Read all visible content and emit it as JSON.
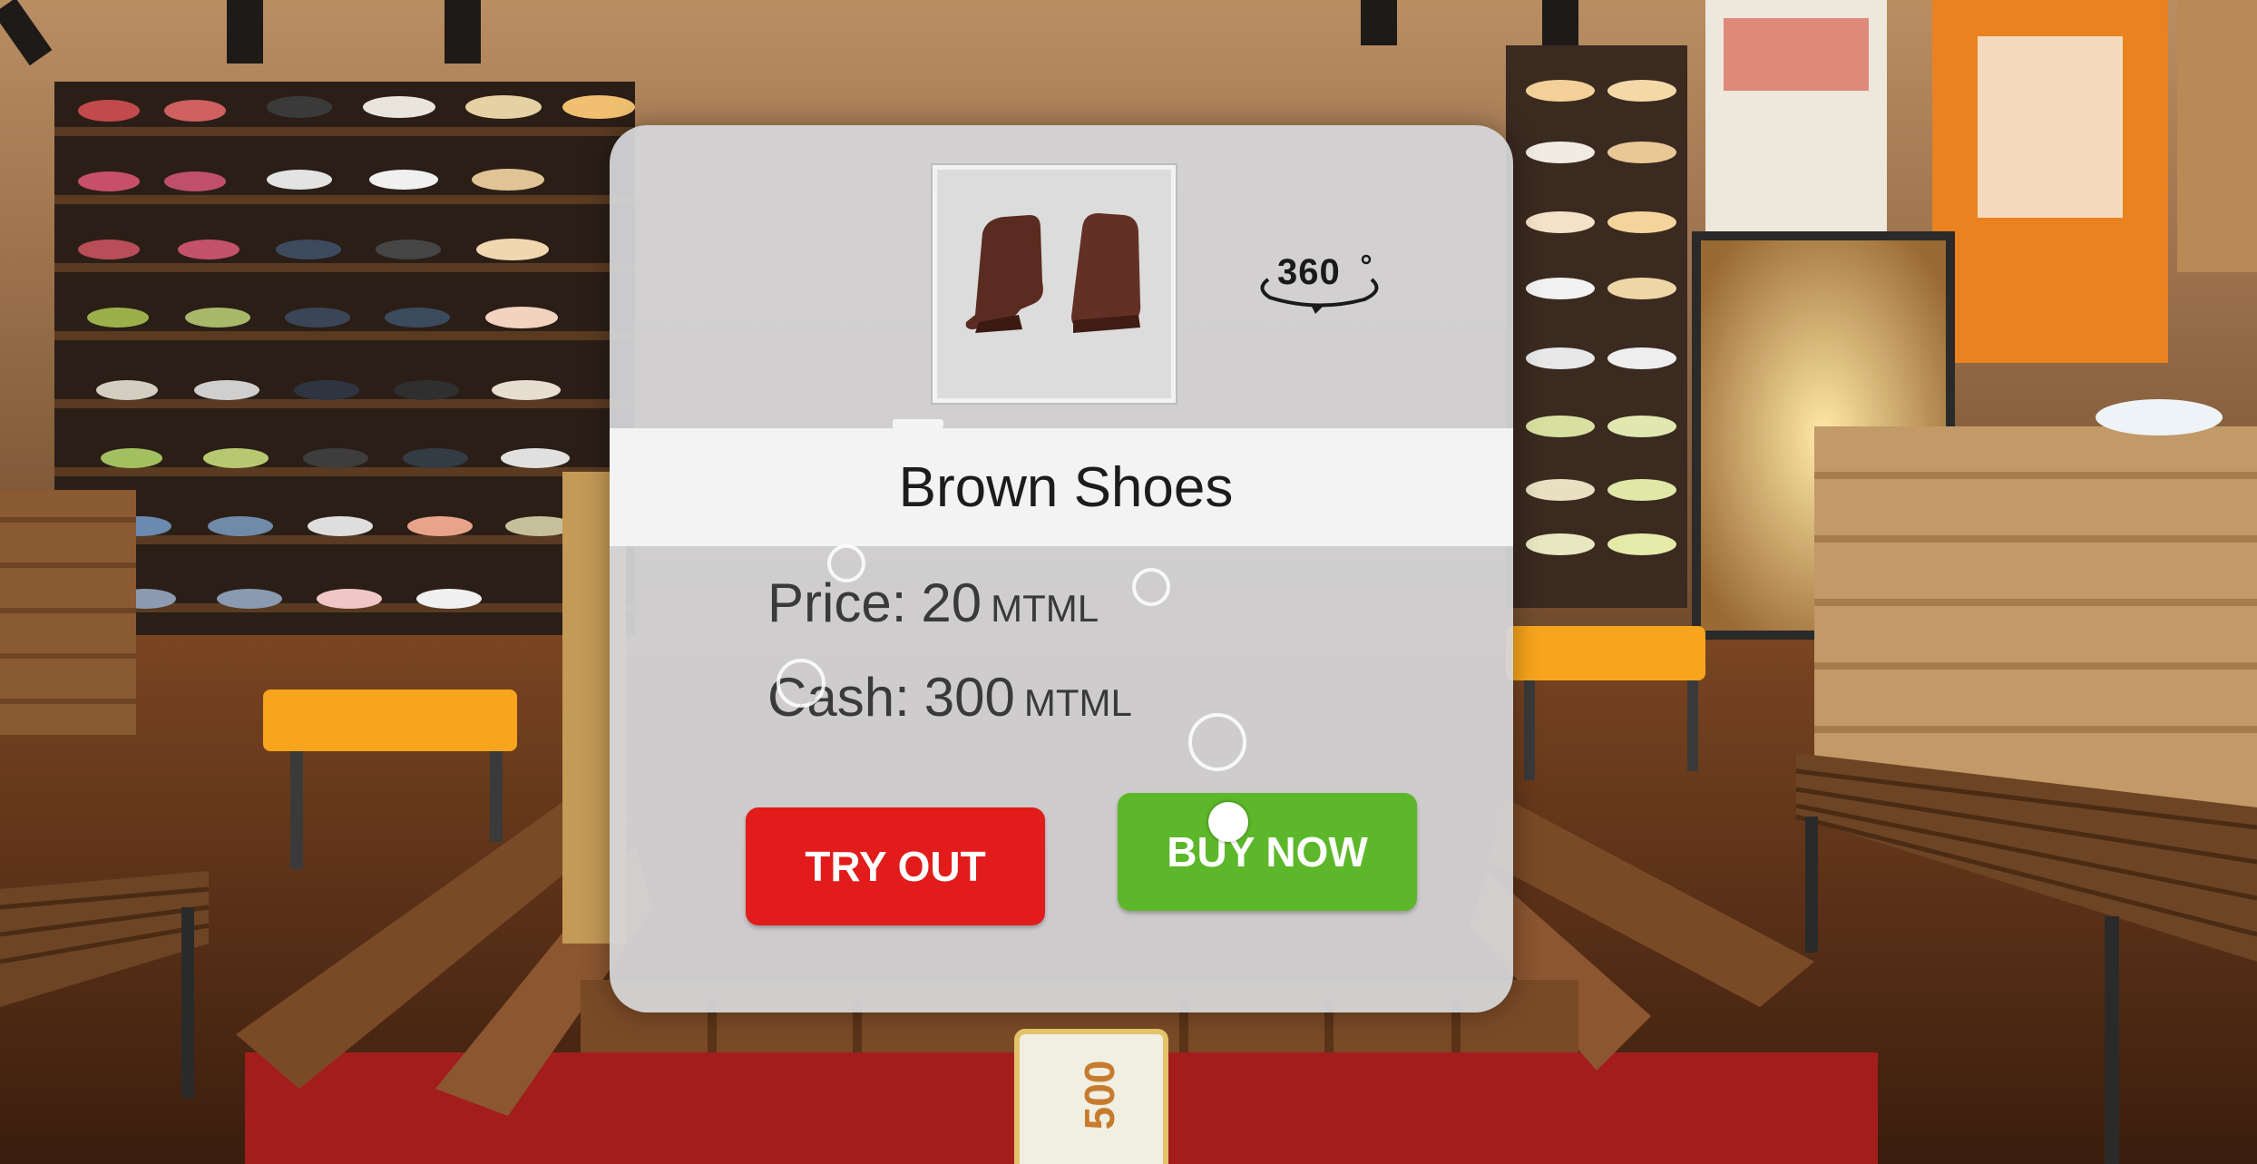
{
  "product": {
    "name": "Brown Shoes",
    "view360_label": "360",
    "thumbnail_icon": "brown-boots-icon"
  },
  "price": {
    "label": "Price:",
    "value": "20",
    "unit": "MTML"
  },
  "cash": {
    "label": "Cash:",
    "value": "300",
    "unit": "MTML"
  },
  "buttons": {
    "try_out": "TRY OUT",
    "buy_now": "BUY NOW"
  },
  "price_tag": {
    "text": "500"
  },
  "colors": {
    "try_out": "#e21b1b",
    "buy_now": "#5cb82a",
    "panel": "#d6d7da",
    "bench": "#f7a51c"
  }
}
